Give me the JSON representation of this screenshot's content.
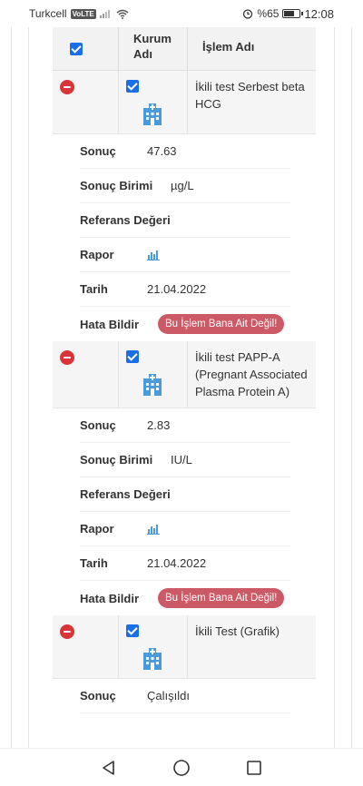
{
  "status_bar": {
    "carrier": "Turkcell",
    "volte": "VoLTE",
    "battery": "%65",
    "time": "12:08"
  },
  "table": {
    "headers": {
      "kurum": "Kurum Adı",
      "islem": "İşlem Adı"
    },
    "labels": {
      "sonuc": "Sonuç",
      "birim": "Sonuç Birimi",
      "referans": "Referans Değeri",
      "rapor": "Rapor",
      "tarih": "Tarih",
      "hata": "Hata Bildir"
    },
    "error_button": "Bu İşlem Bana Ait Değil!",
    "items": [
      {
        "name": "İkili test Serbest beta HCG",
        "result": "47.63",
        "unit": "µg/L",
        "reference": "",
        "date": "21.04.2022"
      },
      {
        "name": "İkili test PAPP-A (Pregnant Associated Plasma Protein A)",
        "result": "2.83",
        "unit": "IU/L",
        "reference": "",
        "date": "21.04.2022"
      },
      {
        "name": "İkili Test (Grafik)",
        "result": "Çalışıldı"
      }
    ]
  },
  "colors": {
    "accent": "#1b6fe6",
    "danger": "#d9343a",
    "error_button": "#cc5a66",
    "icon_blue": "#4a9bd8"
  }
}
